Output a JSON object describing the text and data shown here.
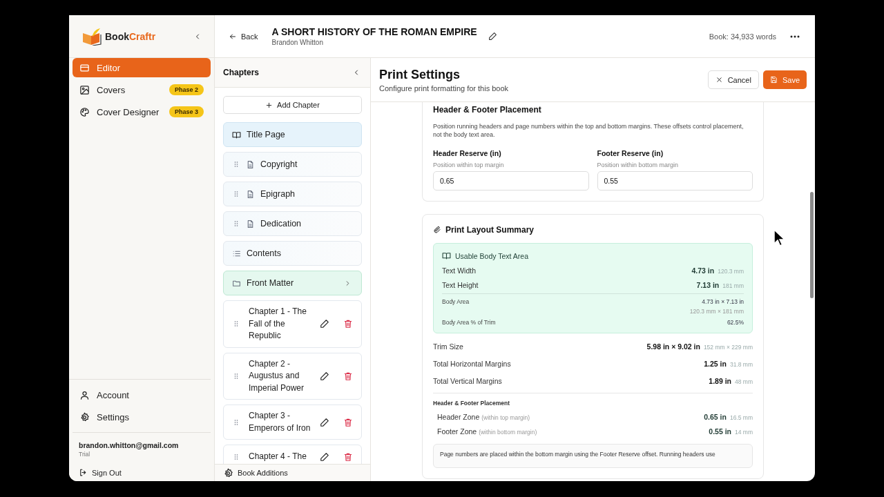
{
  "brand_parts": [
    "Book",
    "Craftr"
  ],
  "nav": [
    {
      "label": "Editor",
      "selected": true
    },
    {
      "label": "Covers",
      "selected": false,
      "badge": "Phase 2"
    },
    {
      "label": "Cover Designer",
      "selected": false,
      "badge": "Phase 3"
    }
  ],
  "account_nav": [
    "Account",
    "Settings"
  ],
  "user": {
    "email": "brandon.whitton@gmail.com",
    "plan": "Trial",
    "sign_out": "Sign Out"
  },
  "top_bar": {
    "back": "Back",
    "book_title": "A SHORT HISTORY OF THE ROMAN EMPIRE",
    "author": "Brandon Whitton",
    "word_count": "Book: 34,933 words"
  },
  "chapters": {
    "title": "Chapters",
    "add": "Add Chapter",
    "footer": "Book Additions",
    "items": [
      {
        "kind": "special",
        "label": "Title Page",
        "selected": true
      },
      {
        "kind": "page",
        "label": "Copyright",
        "selected": false
      },
      {
        "kind": "page",
        "label": "Epigraph",
        "selected": false
      },
      {
        "kind": "page",
        "label": "Dedication",
        "selected": false
      },
      {
        "kind": "contents",
        "label": "Contents",
        "selected": false
      },
      {
        "kind": "folder",
        "label": "Front Matter",
        "selected": false
      },
      {
        "kind": "chapter",
        "label": "Chapter 1 - The Fall of the Republic",
        "selected": false
      },
      {
        "kind": "chapter",
        "label": "Chapter 2 - Augustus and Imperial Power",
        "selected": false
      },
      {
        "kind": "chapter",
        "label": "Chapter 3 - Emperors of Iron",
        "selected": false
      },
      {
        "kind": "chapter",
        "label": "Chapter 4 - The",
        "selected": false
      }
    ]
  },
  "print": {
    "title": "Print Settings",
    "subtitle": "Configure print formatting for this book",
    "cancel": "Cancel",
    "save": "Save"
  },
  "placement": {
    "title": "Header & Footer Placement",
    "description": "Position running headers and page numbers within the top and bottom margins. These offsets control placement, not the body text area.",
    "fields": [
      {
        "label": "Header Reserve (in)",
        "hint": "Position within top margin",
        "value": "0.65"
      },
      {
        "label": "Footer Reserve (in)",
        "hint": "Position within bottom margin",
        "value": "0.55"
      }
    ]
  },
  "summary": {
    "title": "Print Layout Summary",
    "usable": {
      "title": "Usable Body Text Area",
      "rows": [
        {
          "label": "Text Width",
          "value": "4.73 in",
          "sub": "120.3 mm"
        },
        {
          "label": "Text Height",
          "value": "7.13 in",
          "sub": "181 mm"
        }
      ],
      "details": [
        {
          "label": "Body Area",
          "value": "4.73 in × 7.13 in",
          "sub": "120.3 mm × 181 mm"
        },
        {
          "label": "Body Area % of Trim",
          "value": "62.5%"
        }
      ]
    },
    "rows": [
      {
        "label": "Trim Size",
        "value": "5.98 in × 9.02 in",
        "sub": "152 mm × 229 mm"
      },
      {
        "label": "Total Horizontal Margins",
        "value": "1.25 in",
        "sub": "31.8 mm"
      },
      {
        "label": "Total Vertical Margins",
        "value": "1.89 in",
        "sub": "48 mm"
      }
    ],
    "zones_title": "Header & Footer Placement",
    "zones": [
      {
        "label": "Header Zone",
        "qualifier": "(within top margin)",
        "value": "0.65 in",
        "sub": "16.5 mm"
      },
      {
        "label": "Footer Zone",
        "qualifier": "(within bottom margin)",
        "value": "0.55 in",
        "sub": "14 mm"
      }
    ],
    "note": "Page numbers are placed within the bottom margin using the Footer Reserve offset. Running headers use"
  }
}
